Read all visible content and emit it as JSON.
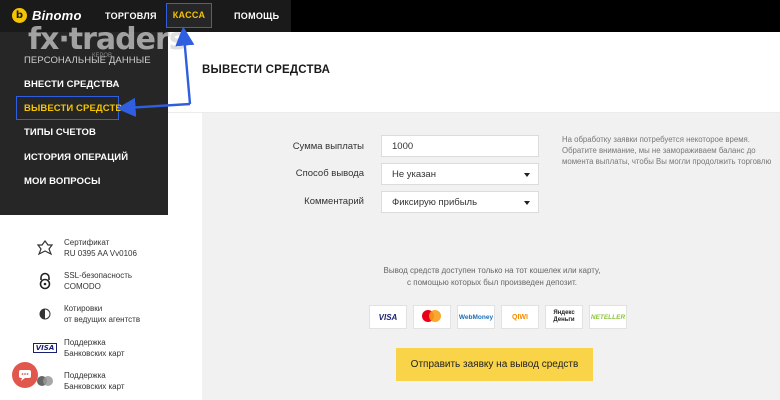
{
  "header": {
    "logo_text": "Binomo",
    "nav": [
      {
        "label": "ТОРГОВЛЯ"
      },
      {
        "label": "КАССА"
      },
      {
        "label": "ПОМОЩЬ"
      }
    ]
  },
  "watermark": {
    "text": "fx·traders",
    "sub": "КЕРОВ"
  },
  "sidebar": {
    "items": [
      {
        "label": "ПЕРСОНАЛЬНЫЕ ДАННЫЕ"
      },
      {
        "label": "ВНЕСТИ СРЕДСТВА"
      },
      {
        "label": "ВЫВЕСТИ СРЕДСТВА"
      },
      {
        "label": "ТИПЫ СЧЕТОВ"
      },
      {
        "label": "ИСТОРИЯ ОПЕРАЦИЙ"
      },
      {
        "label": "МОИ ВОПРОСЫ"
      }
    ],
    "trust": [
      {
        "line1": "Сертификат",
        "line2": "RU 0395 AA Vv0106",
        "icon": "certificate-icon"
      },
      {
        "line1": "SSL-безопасность",
        "line2": "COMODO",
        "icon": "lock-icon"
      },
      {
        "line1": "Котировки",
        "line2": "от ведущих агентств",
        "icon": "quotes-icon"
      },
      {
        "line1": "Поддержка",
        "line2": "Банковских карт",
        "icon": "visa-icon",
        "icon_text": "VISA"
      },
      {
        "line1": "Поддержка",
        "line2": "Банковских карт",
        "icon": "mastercard-securecode-icon"
      }
    ]
  },
  "main": {
    "title": "ВЫВЕСТИ СРЕДСТВА",
    "form": {
      "amount_label": "Сумма выплаты",
      "amount_value": "1000",
      "method_label": "Способ вывода",
      "method_value": "Не указан",
      "comment_label": "Комментарий",
      "comment_value": "Фиксирую прибыль"
    },
    "note": "На обработку заявки потребуется некоторое время. Обратите внимание, мы не замораживаем баланс до момента выплаты, чтобы Вы могли продолжить торговлю",
    "notice": "Вывод средств доступен только на тот кошелек или карту, с помощью которых был произведен депозит.",
    "payment_methods": [
      {
        "name": "VISA"
      },
      {
        "name": "mastercard"
      },
      {
        "name": "WebMoney"
      },
      {
        "name": "QIWI"
      },
      {
        "name": "Яндекс Деньги"
      },
      {
        "name": "NETELLER"
      }
    ],
    "submit_label": "Отправить заявку на вывод средств"
  },
  "colors": {
    "accent": "#f5c400",
    "topbar": "#1a1a1a",
    "sidebar": "#262626",
    "annotation": "#2f5fe0",
    "button": "#f9d448"
  }
}
